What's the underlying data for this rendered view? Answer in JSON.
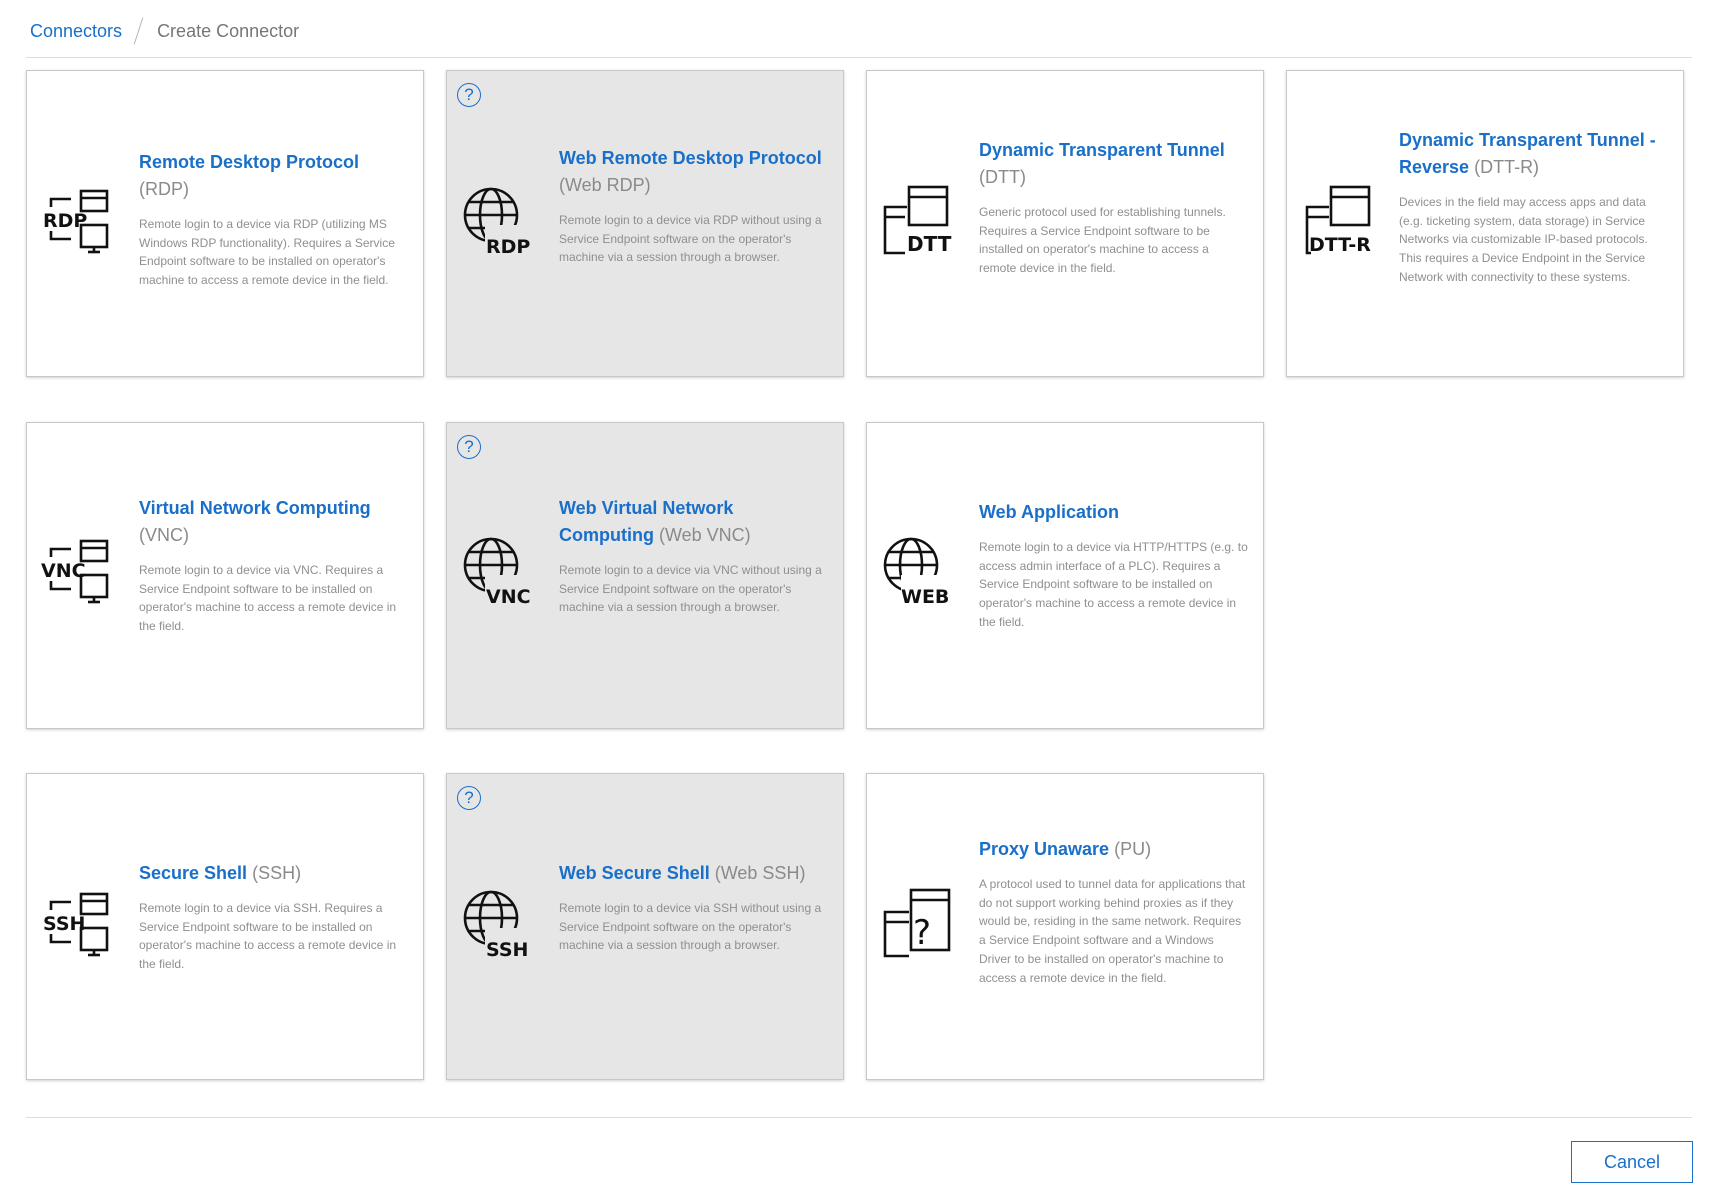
{
  "breadcrumb": {
    "root": "Connectors",
    "current": "Create Connector"
  },
  "colors": {
    "accent": "#1a6fc9",
    "web_card_bg": "#e6e6e6",
    "desc_text": "#8f8f8f"
  },
  "cards": [
    {
      "name": "Remote Desktop Protocol",
      "abbr": "(RDP)",
      "icon": "rdp-monitor-icon",
      "icon_label": "RDP",
      "help": false,
      "desc": "Remote login to a device via RDP (utilizing MS Windows RDP functionality). Requires a Service Endpoint software to be installed on operator's machine to access a remote device in the field."
    },
    {
      "name": "Web Remote Desktop Protocol",
      "abbr": "(Web RDP)",
      "icon": "rdp-globe-icon",
      "icon_label": "RDP",
      "help": true,
      "help_glyph": "?",
      "desc": "Remote login to a device via RDP without using a Service Endpoint software on the operator's machine via a session through a browser."
    },
    {
      "name": "Dynamic Transparent Tunnel",
      "abbr": "(DTT)",
      "icon": "dtt-window-icon",
      "icon_label": "DTT",
      "help": false,
      "desc": "Generic protocol used for establishing tunnels. Requires a Service Endpoint software to be installed on operator's machine to access a remote device in the field."
    },
    {
      "name": "Dynamic Transparent Tunnel - Reverse",
      "abbr": "(DTT-R)",
      "icon": "dtt-r-window-icon",
      "icon_label": "DTT-R",
      "help": false,
      "desc": "Devices in the field may access apps and data (e.g. ticketing system, data storage) in Service Networks via customizable IP-based protocols. This requires a Device Endpoint in the Service Network with connectivity to these systems."
    },
    {
      "name": "Virtual Network Computing",
      "abbr": "(VNC)",
      "icon": "vnc-monitor-icon",
      "icon_label": "VNC",
      "help": false,
      "desc": "Remote login to a device via VNC. Requires a Service Endpoint software to be installed on operator's machine to access a remote device in the field."
    },
    {
      "name": "Web Virtual Network Computing",
      "abbr": "(Web VNC)",
      "icon": "vnc-globe-icon",
      "icon_label": "VNC",
      "help": true,
      "help_glyph": "?",
      "desc": "Remote login to a device via VNC without using a Service Endpoint software on the operator's machine via a session through a browser."
    },
    {
      "name": "Web Application",
      "abbr": "",
      "icon": "web-globe-icon",
      "icon_label": "WEB",
      "help": false,
      "desc": "Remote login to a device via HTTP/HTTPS (e.g. to access admin interface of a PLC). Requires a Service Endpoint software to be installed on operator's machine to access a remote device in the field."
    },
    {
      "name": "Secure Shell",
      "abbr": "(SSH)",
      "icon": "ssh-monitor-icon",
      "icon_label": "SSH",
      "help": false,
      "desc": "Remote login to a device via SSH. Requires a Service Endpoint software to be installed on operator's machine to access a remote device in the field."
    },
    {
      "name": "Web Secure Shell",
      "abbr": "(Web SSH)",
      "icon": "ssh-globe-icon",
      "icon_label": "SSH",
      "help": true,
      "help_glyph": "?",
      "desc": "Remote login to a device via SSH without using a Service Endpoint software on the operator's machine via a session through a browser."
    },
    {
      "name": "Proxy Unaware",
      "abbr": "(PU)",
      "icon": "proxy-unaware-icon",
      "icon_label": "?",
      "help": false,
      "desc": "A protocol used to tunnel data for applications that do not support working behind proxies as if they would be, residing in the same network. Requires a Service Endpoint software and a Windows Driver to be installed on operator's machine to access a remote device in the field."
    }
  ],
  "footer": {
    "cancel_label": "Cancel"
  }
}
